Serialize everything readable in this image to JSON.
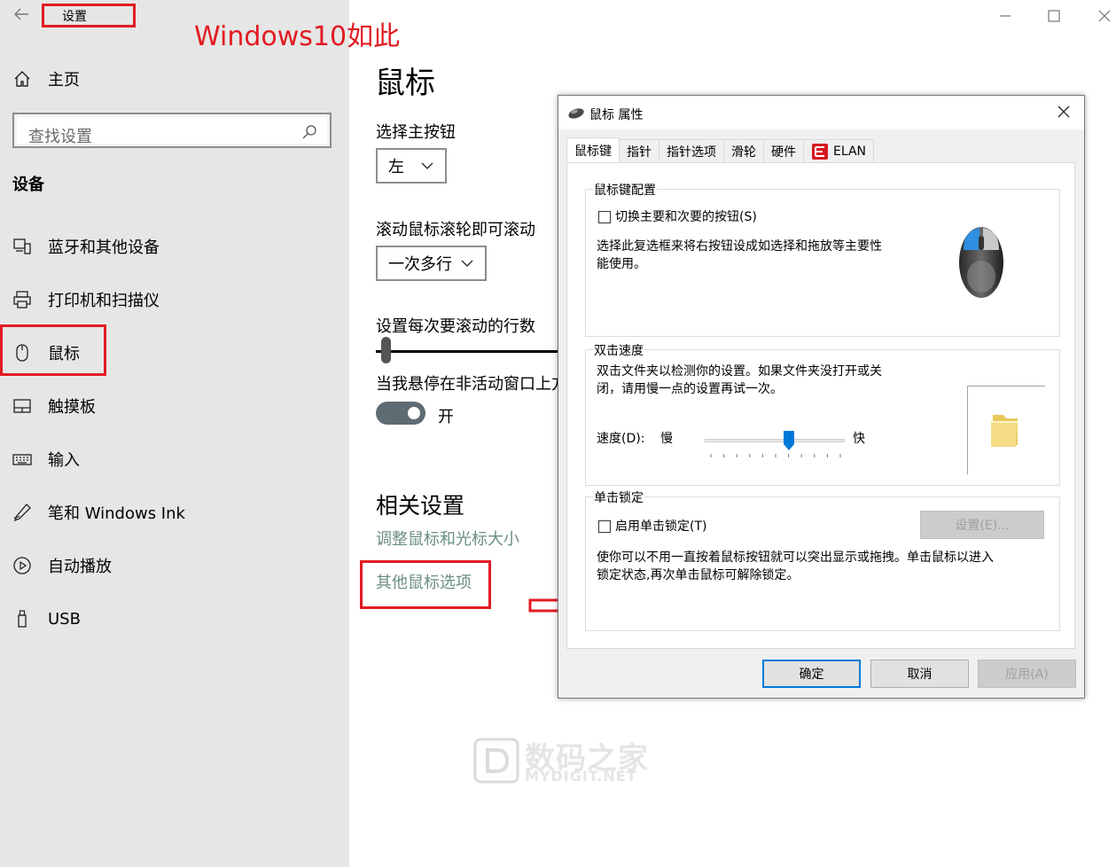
{
  "settings": {
    "title": "设置",
    "annotation_note": "Windows10如此",
    "home_label": "主页",
    "search_placeholder": "查找设置",
    "section_heading": "设备",
    "nav": [
      {
        "label": "蓝牙和其他设备",
        "icon": "bluetooth-devices-icon"
      },
      {
        "label": "打印机和扫描仪",
        "icon": "printer-icon"
      },
      {
        "label": "鼠标",
        "icon": "mouse-icon"
      },
      {
        "label": "触摸板",
        "icon": "touchpad-icon"
      },
      {
        "label": "输入",
        "icon": "keyboard-icon"
      },
      {
        "label": "笔和 Windows Ink",
        "icon": "pen-icon"
      },
      {
        "label": "自动播放",
        "icon": "autoplay-icon"
      },
      {
        "label": "USB",
        "icon": "usb-icon"
      }
    ]
  },
  "main": {
    "page_title": "鼠标",
    "primary_button_label": "选择主按钮",
    "primary_button_value": "左",
    "scroll_label": "滚动鼠标滚轮即可滚动",
    "scroll_value": "一次多行",
    "lines_label": "设置每次要滚动的行数",
    "lines_slider_fraction": 0.05,
    "inactive_scroll_label": "当我悬停在非活动窗口上方",
    "inactive_scroll_toggle": "开",
    "related_heading": "相关设置",
    "related_link_1": "调整鼠标和光标大小",
    "related_link_2": "其他鼠标选项"
  },
  "dialog": {
    "title": "鼠标 属性",
    "tabs": [
      "鼠标键",
      "指针",
      "指针选项",
      "滑轮",
      "硬件",
      "ELAN"
    ],
    "button_config": {
      "title": "鼠标键配置",
      "checkbox_label": "切换主要和次要的按钮(S)",
      "desc_line1": "选择此复选框来将右按钮设成如选择和拖放等主要性",
      "desc_line2": "能使用。"
    },
    "double_click": {
      "title": "双击速度",
      "desc_line1": "双击文件夹以检测你的设置。如果文件夹没打开或关",
      "desc_line2": "闭，请用慢一点的设置再试一次。",
      "speed_label": "速度(D):",
      "slow": "慢",
      "fast": "快",
      "speed_fraction": 0.6
    },
    "click_lock": {
      "title": "单击锁定",
      "checkbox_label": "启用单击锁定(T)",
      "settings_button": "设置(E)...",
      "desc_line1": "使你可以不用一直按着鼠标按钮就可以突出显示或拖拽。单击鼠标以进入",
      "desc_line2": "锁定状态,再次单击鼠标可解除锁定。"
    },
    "buttons": {
      "ok": "确定",
      "cancel": "取消",
      "apply": "应用(A)"
    }
  },
  "watermark": {
    "cn": "数码之家",
    "en": "MYDIGIT.NET"
  },
  "colors": {
    "annotation": "#e11b22",
    "accent": "#0078d7",
    "link": "#6b8f7f"
  }
}
